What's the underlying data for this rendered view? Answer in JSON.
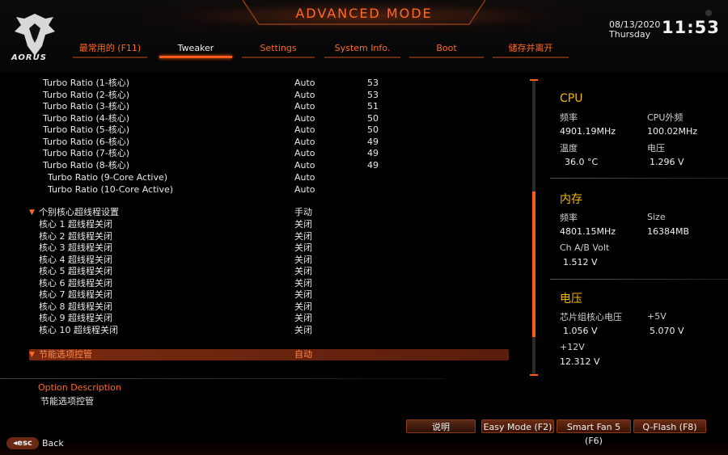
{
  "header": {
    "title": "ADVANCED MODE",
    "logo_text": "AORUS",
    "date": "08/13/2020",
    "day": "Thursday",
    "time": "11:53"
  },
  "tabs": [
    {
      "label": "最常用的 (F11)",
      "active": false
    },
    {
      "label": "Tweaker",
      "active": true
    },
    {
      "label": "Settings",
      "active": false
    },
    {
      "label": "System Info.",
      "active": false
    },
    {
      "label": "Boot",
      "active": false
    },
    {
      "label": "储存并离开",
      "active": false
    }
  ],
  "turbo_ratios": [
    {
      "label": "Turbo Ratio (1-核心)",
      "value": "Auto",
      "current": "53"
    },
    {
      "label": "Turbo Ratio (2-核心)",
      "value": "Auto",
      "current": "53"
    },
    {
      "label": "Turbo Ratio (3-核心)",
      "value": "Auto",
      "current": "51"
    },
    {
      "label": "Turbo Ratio (4-核心)",
      "value": "Auto",
      "current": "50"
    },
    {
      "label": "Turbo Ratio (5-核心)",
      "value": "Auto",
      "current": "50"
    },
    {
      "label": "Turbo Ratio (6-核心)",
      "value": "Auto",
      "current": "49"
    },
    {
      "label": "Turbo Ratio (7-核心)",
      "value": "Auto",
      "current": "49"
    },
    {
      "label": "Turbo Ratio (8-核心)",
      "value": "Auto",
      "current": "49"
    }
  ],
  "turbo_ratios_active": [
    {
      "label": "Turbo Ratio (9-Core Active)",
      "value": "Auto"
    },
    {
      "label": "Turbo Ratio (10-Core Active)",
      "value": "Auto"
    }
  ],
  "ht_section": {
    "label": "个别核心超线程设置",
    "value": "手动"
  },
  "ht_cores": [
    {
      "label": "核心 1 超线程关闭",
      "value": "关闭"
    },
    {
      "label": "核心 2 超线程关闭",
      "value": "关闭"
    },
    {
      "label": "核心 3 超线程关闭",
      "value": "关闭"
    },
    {
      "label": "核心 4 超线程关闭",
      "value": "关闭"
    },
    {
      "label": "核心 5 超线程关闭",
      "value": "关闭"
    },
    {
      "label": "核心 6 超线程关闭",
      "value": "关闭"
    },
    {
      "label": "核心 7 超线程关闭",
      "value": "关闭"
    },
    {
      "label": "核心 8 超线程关闭",
      "value": "关闭"
    },
    {
      "label": "核心 9 超线程关闭",
      "value": "关闭"
    },
    {
      "label": "核心 10 超线程关闭",
      "value": "关闭"
    }
  ],
  "power_section": {
    "label": "节能选项控管",
    "value": "自动"
  },
  "info": {
    "cpu": {
      "heading": "CPU",
      "freq_label": "频率",
      "freq_value": "4901.19MHz",
      "bclk_label": "CPU外频",
      "bclk_value": "100.02MHz",
      "temp_label": "温度",
      "temp_value": "36.0 °C",
      "volt_label": "电压",
      "volt_value": "1.296 V"
    },
    "memory": {
      "heading": "内存",
      "freq_label": "频率",
      "freq_value": "4801.15MHz",
      "size_label": "Size",
      "size_value": "16384MB",
      "volt_label": "Ch A/B Volt",
      "volt_value": "1.512 V"
    },
    "voltage": {
      "heading": "电压",
      "chipset_label": "芯片组核心电压",
      "chipset_value": "1.056 V",
      "v5_label": "+5V",
      "v5_value": "5.070 V",
      "v12_label": "+12V",
      "v12_value": "12.312 V"
    }
  },
  "description": {
    "title": "Option Description",
    "text": "节能选项控管"
  },
  "buttons": {
    "help": "说明",
    "easy_mode": "Easy Mode (F2)",
    "smart_fan": "Smart Fan 5 (F6)",
    "qflash": "Q-Flash (F8)"
  },
  "esc": {
    "key": "esc",
    "label": "Back"
  },
  "colors": {
    "accent": "#ff6a25",
    "heading": "#f5b800",
    "selected_bg": "#7a2a10"
  }
}
